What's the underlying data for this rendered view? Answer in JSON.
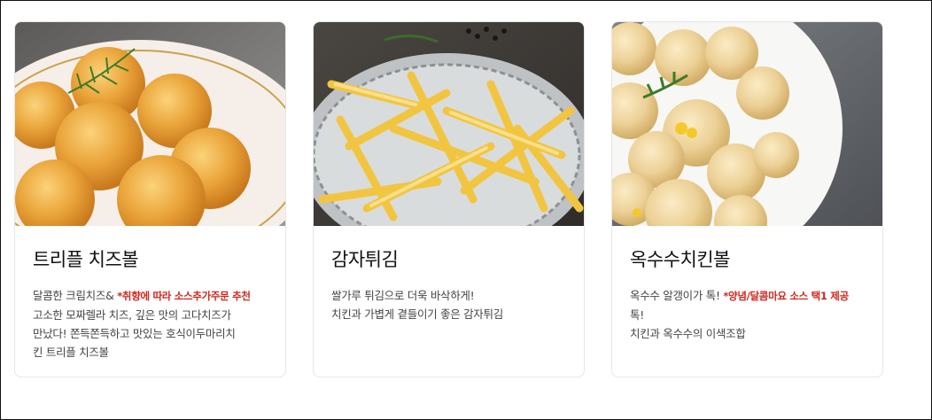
{
  "cards": [
    {
      "image_alt": "치즈볼 사진",
      "title": "트리플 치즈볼",
      "desc_prefix": "달콤한 크림치즈& ",
      "desc_note": "*취향에 따라 소스추가주문 추천",
      "desc_lines": [
        "고소한 모짜렐라 치즈, 깊은 맛의 고다치즈가",
        "만났다! 쫀득쫀득하고 맛있는 호식이두마리치",
        "킨 트리플 치즈볼"
      ]
    },
    {
      "image_alt": "감자튀김 사진",
      "title": "감자튀김",
      "desc_prefix": "쌀가루 튀김으로 더욱 바삭하게!",
      "desc_note": "",
      "desc_lines": [
        "치킨과 가볍게 곁들이기 좋은 감자튀김"
      ]
    },
    {
      "image_alt": "옥수수치킨볼 사진",
      "title": "옥수수치킨볼",
      "desc_prefix": "옥수수 알갱이가 톡! ",
      "desc_note": "*양념/달콤마요 소스 택1 제공",
      "desc_lines": [
        "톡!",
        "치킨과 옥수수의 이색조합"
      ]
    }
  ],
  "colors": {
    "note": "#d0261c",
    "border": "#e6e6e6",
    "title": "#111111",
    "text": "#444444"
  }
}
